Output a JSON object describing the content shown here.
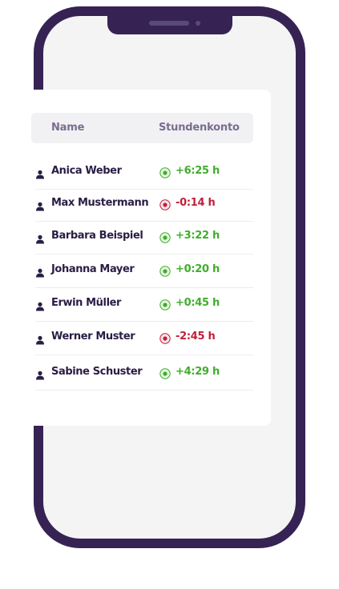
{
  "table": {
    "header": {
      "name": "Name",
      "hours": "Stundenkonto"
    },
    "rows": [
      {
        "name": "Anica Weber",
        "hours": "+6:25 h",
        "status": "positive"
      },
      {
        "name": "Max Mustermann",
        "hours": "-0:14 h",
        "status": "negative"
      },
      {
        "name": "Barbara Beispiel",
        "hours": "+3:22 h",
        "status": "positive"
      },
      {
        "name": "Johanna Mayer",
        "hours": "+0:20 h",
        "status": "positive"
      },
      {
        "name": "Erwin Müller",
        "hours": "+0:45 h",
        "status": "positive"
      },
      {
        "name": "Werner Muster",
        "hours": "-2:45 h",
        "status": "negative"
      },
      {
        "name": "Sabine Schuster",
        "hours": "+4:29 h",
        "status": "positive"
      }
    ]
  },
  "colors": {
    "phone_frame": "#362354",
    "positive": "#3fae2a",
    "negative": "#c0203a",
    "name_text": "#2a1d45",
    "header_text": "#7a6d90"
  },
  "icons": {
    "person": "person-icon",
    "positive_status": "green-dot-icon",
    "negative_status": "red-dot-icon"
  }
}
